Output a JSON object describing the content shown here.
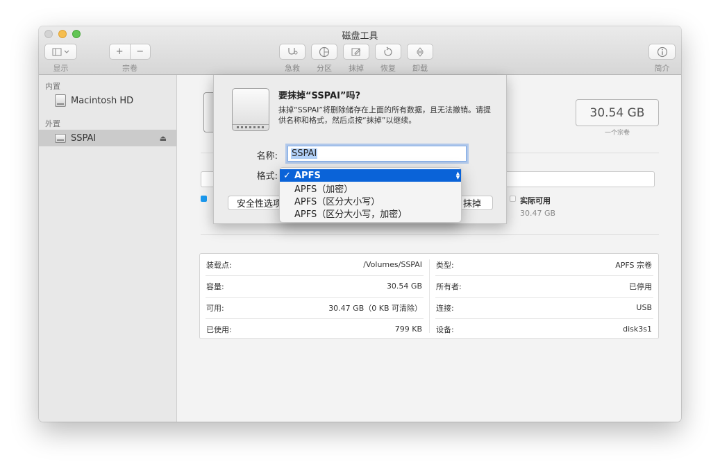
{
  "window": {
    "title": "磁盘工具"
  },
  "toolbar": {
    "view_label": "显示",
    "volume_label": "宗卷",
    "firstaid_label": "急救",
    "partition_label": "分区",
    "erase_label": "抹掉",
    "restore_label": "恢复",
    "unmount_label": "卸载",
    "info_label": "简介",
    "plus_glyph": "+",
    "minus_glyph": "−"
  },
  "sidebar": {
    "internal_header": "内置",
    "external_header": "外置",
    "items": [
      {
        "label": "Macintosh HD"
      },
      {
        "label": "SSPAI"
      }
    ]
  },
  "main": {
    "capacity": "30.54 GB",
    "capacity_sub": "一个宗卷",
    "legend": {
      "available_label": "实际可用",
      "available_value": "30.47 GB"
    }
  },
  "info_table": {
    "left": [
      {
        "key": "装载点:",
        "value": "/Volumes/SSPAI"
      },
      {
        "key": "容量:",
        "value": "30.54 GB"
      },
      {
        "key": "可用:",
        "value": "30.47 GB（0 KB 可清除）"
      },
      {
        "key": "已使用:",
        "value": "799 KB"
      }
    ],
    "right": [
      {
        "key": "类型:",
        "value": "APFS 宗卷"
      },
      {
        "key": "所有者:",
        "value": "已停用"
      },
      {
        "key": "连接:",
        "value": "USB"
      },
      {
        "key": "设备:",
        "value": "disk3s1"
      }
    ]
  },
  "sheet": {
    "title": "要抹掉“SSPAI”吗?",
    "message": "抹掉“SSPAI”将删除储存在上面的所有数据，且无法撤销。请提供名称和格式，然后点按“抹掉”以继续。",
    "name_label": "名称:",
    "name_value": "SSPAI",
    "format_label": "格式:",
    "security_button": "安全性选项",
    "erase_button": "抹掉",
    "format_options": [
      {
        "label": "APFS",
        "selected": true
      },
      {
        "label": "APFS（加密）"
      },
      {
        "label": "APFS（区分大小写）"
      },
      {
        "label": "APFS（区分大小写，加密）"
      }
    ]
  },
  "colors": {
    "accent": "#0a63d8",
    "used_dot": "#1b9af0",
    "traffic_min": "#f6be4f",
    "traffic_max": "#62c555"
  },
  "icons": {
    "checkmark": "✓",
    "eject": "⏏"
  }
}
